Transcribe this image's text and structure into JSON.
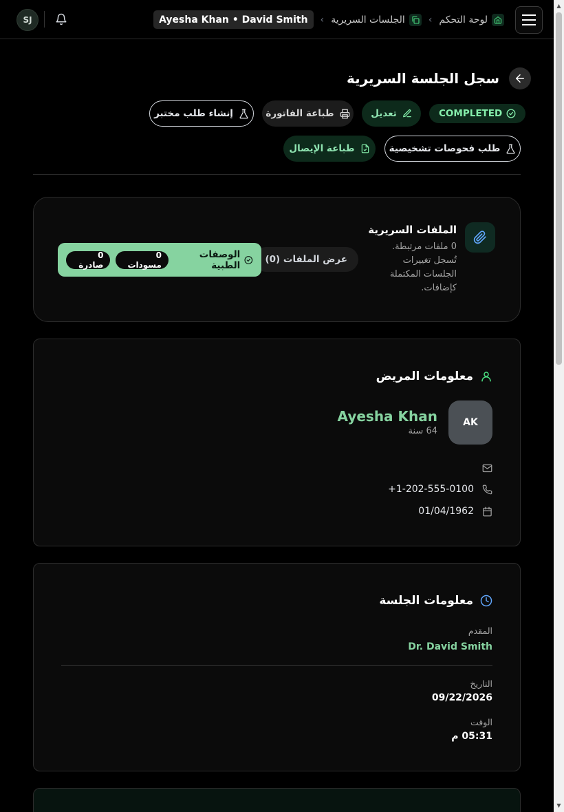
{
  "header": {
    "avatar_initials": "SJ",
    "breadcrumbs": [
      {
        "label": "لوحة التحكم"
      },
      {
        "label": "الجلسات السريرية"
      }
    ],
    "current_crumb": "Ayesha Khan • David Smith"
  },
  "page": {
    "title": "سجل الجلسة السريرية",
    "status": "COMPLETED",
    "actions": {
      "edit": "تعديل",
      "print_invoice": "طباعة الفاتورة",
      "create_lab_request": "إنشاء طلب مختبر",
      "print_receipt": "طباعة الإيصال",
      "diagnostic_request": "طلب فحوصات تشخيصية"
    }
  },
  "files_card": {
    "title": "الملفات السريرية",
    "description": "0 ملفات مرتبطة. تُسجل تغييرات الجلسات المكتملة كإضافات.",
    "view_files": "عرض الملفات (0)",
    "prescriptions_label": "الوصفات الطبية",
    "drafts": "0 مسودات",
    "issued": "0 صادرة"
  },
  "patient_card": {
    "title": "معلومات المريض",
    "initials": "AK",
    "name": "Ayesha Khan",
    "age": "64 سنة",
    "phone": "+1-202-555-0100",
    "dob": "01/04/1962"
  },
  "session_card": {
    "title": "معلومات الجلسة",
    "provider_label": "المقدم",
    "provider": "Dr. David Smith",
    "date_label": "التاريخ",
    "date": "09/22/2026",
    "time_label": "الوقت",
    "time": "05:31 م"
  },
  "colors": {
    "accent_green": "#86d3a0",
    "status_bg": "#0d2a1b",
    "background": "#000000"
  }
}
